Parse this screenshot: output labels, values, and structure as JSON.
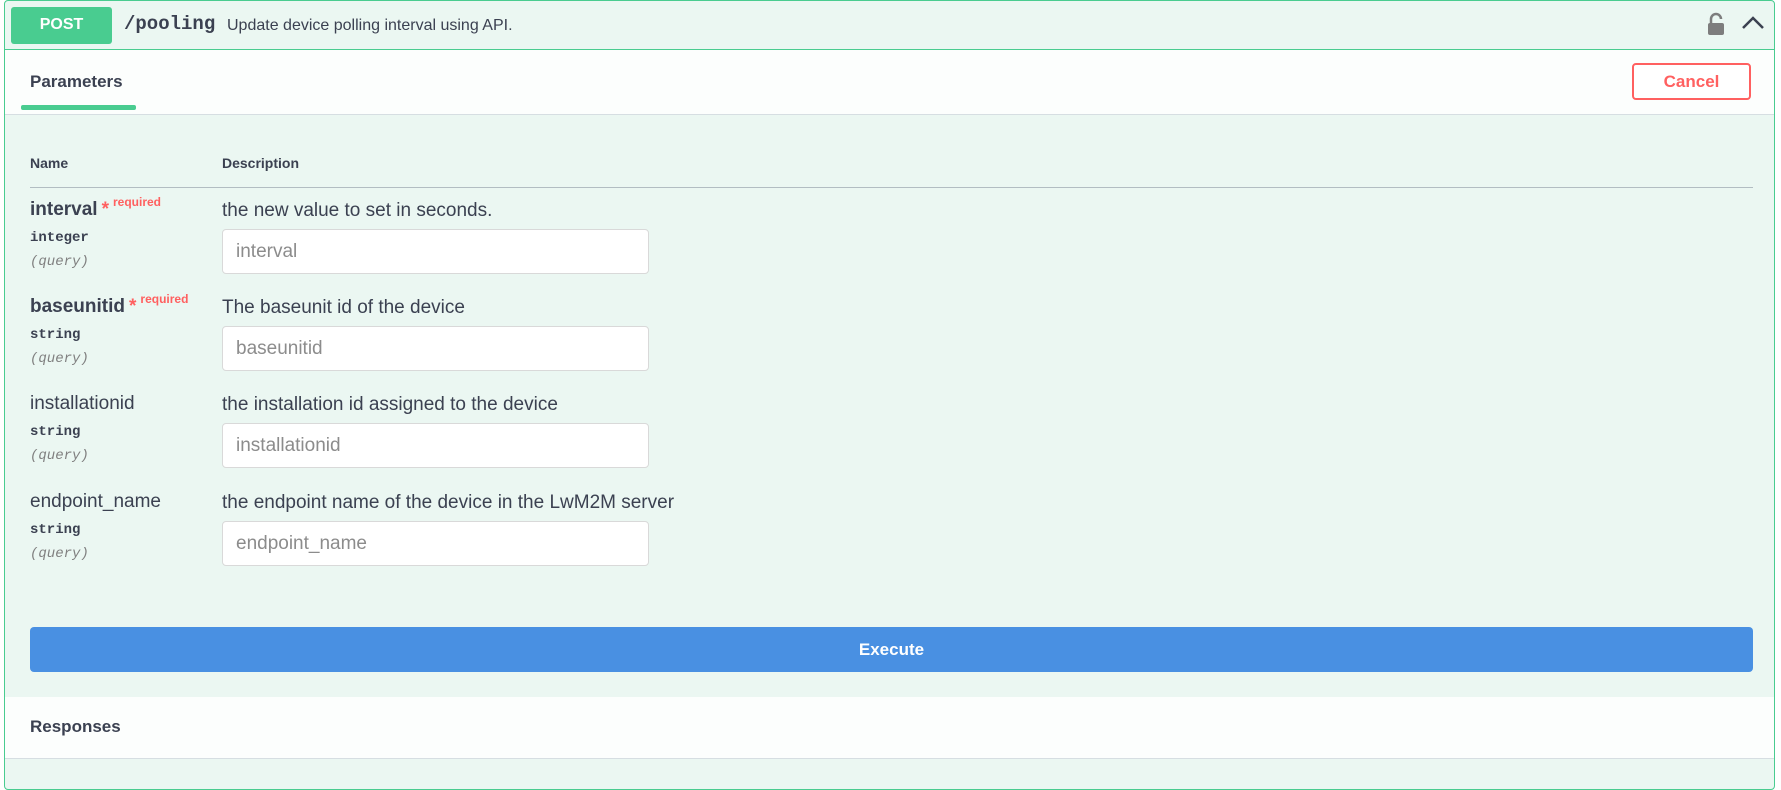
{
  "operation": {
    "method": "POST",
    "path": "/pooling",
    "summary": "Update device polling interval using API.",
    "color": "#49cc90",
    "lock_icon": "lock-icon",
    "collapse_icon": "chevron-up-icon"
  },
  "parameters_section": {
    "tab_label": "Parameters",
    "cancel_label": "Cancel",
    "col_name": "Name",
    "col_description": "Description"
  },
  "params": [
    {
      "name": "interval",
      "required": true,
      "required_label": "required",
      "type": "integer",
      "in": "(query)",
      "description": "the new value to set in seconds.",
      "placeholder": "interval",
      "value": ""
    },
    {
      "name": "baseunitid",
      "required": true,
      "required_label": "required",
      "type": "string",
      "in": "(query)",
      "description": "The baseunit id of the device",
      "placeholder": "baseunitid",
      "value": ""
    },
    {
      "name": "installationid",
      "required": false,
      "type": "string",
      "in": "(query)",
      "description": "the installation id assigned to the device",
      "placeholder": "installationid",
      "value": ""
    },
    {
      "name": "endpoint_name",
      "required": false,
      "type": "string",
      "in": "(query)",
      "description": "the endpoint name of the device in the LwM2M server",
      "placeholder": "endpoint_name",
      "value": ""
    }
  ],
  "execute_label": "Execute",
  "execute_color": "#4990e2",
  "responses_title": "Responses"
}
